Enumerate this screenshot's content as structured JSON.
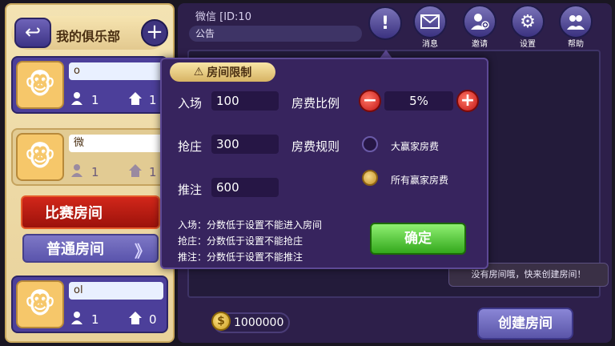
{
  "club": {
    "title": "我的俱乐部"
  },
  "room_cards": [
    {
      "name": "o",
      "players": "1",
      "tables": "1"
    },
    {
      "name": "微",
      "players": "1",
      "tables": "1"
    },
    {
      "name": "ol",
      "players": "1",
      "tables": "0"
    }
  ],
  "tabs": {
    "match": "比赛房间",
    "normal": "普通房间",
    "arrows": "》"
  },
  "header": {
    "wechat": "微信 [ID:10",
    "notice": "公告"
  },
  "top_icons": [
    {
      "name": "alert",
      "label": ""
    },
    {
      "name": "mail",
      "label": "消息"
    },
    {
      "name": "invite",
      "label": "邀请"
    },
    {
      "name": "settings",
      "label": "设置"
    },
    {
      "name": "help",
      "label": "帮助"
    }
  ],
  "modal": {
    "title": "房间限制",
    "entry_label": "入场",
    "entry_value": "100",
    "banker_label": "抢庄",
    "banker_value": "300",
    "bet_label": "推注",
    "bet_value": "600",
    "fee_ratio_label": "房费比例",
    "fee_ratio_value": "5%",
    "fee_rule_label": "房费规则",
    "rule_option_1": "大赢家房费",
    "rule_option_2": "所有赢家房费",
    "selected_rule": "所有赢家房费",
    "notes": [
      "入场：分数低于设置不能进入房间",
      "抢庄：分数低于设置不能抢庄",
      "推注：分数低于设置不能推注"
    ],
    "confirm": "确定"
  },
  "footer": {
    "coins": "1000000",
    "no_room_tip": "没有房间哦，快来创建房间！",
    "create_room": "创建房间"
  },
  "colors": {
    "accent_purple": "#37245e",
    "confirm_green": "#33a81c",
    "danger_red": "#c21414",
    "gold": "#d7b464"
  }
}
